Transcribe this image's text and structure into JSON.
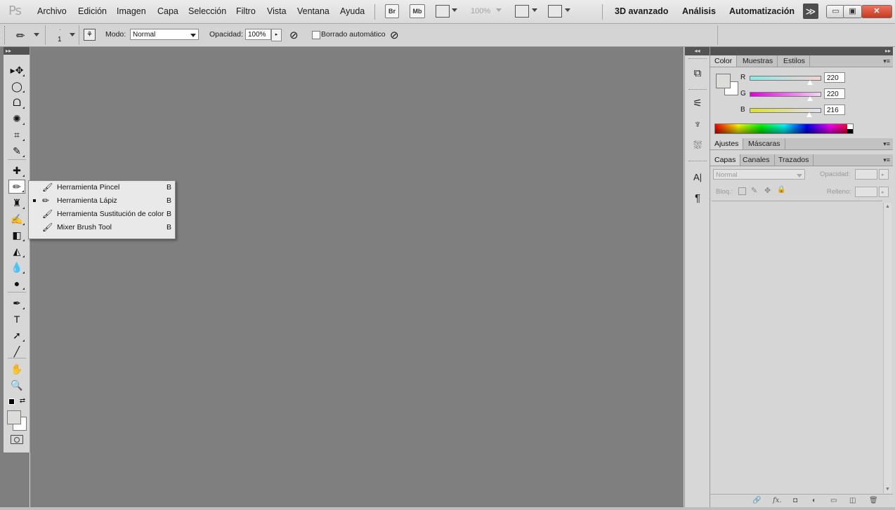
{
  "app": {
    "logo": "Ps",
    "menu": [
      "Archivo",
      "Edición",
      "Imagen",
      "Capa",
      "Selección",
      "Filtro",
      "Vista",
      "Ventana",
      "Ayuda"
    ],
    "bridge_label": "Br",
    "minibridge_label": "Mb",
    "zoom": "100%",
    "workspaces": [
      "3D avanzado",
      "Análisis",
      "Automatización"
    ],
    "more_glyph": "≫",
    "window_buttons": {
      "minimize": "▭",
      "restore": "▣",
      "close": "✕"
    }
  },
  "options": {
    "brush_size": "1",
    "mode_label": "Modo:",
    "mode_value": "Normal",
    "opacity_label": "Opacidad:",
    "opacity_value": "100%",
    "auto_erase_label": "Borrado automático"
  },
  "toolbox": {
    "collapse_glyph": "▸▸",
    "tools": [
      {
        "name": "move-tool-icon",
        "glyph": "▸✥"
      },
      {
        "name": "marquee-tool-icon",
        "glyph": "◯"
      },
      {
        "name": "lasso-tool-icon",
        "glyph": "ᗝ"
      },
      {
        "name": "quick-selection-tool-icon",
        "glyph": "✺"
      },
      {
        "name": "crop-tool-icon",
        "glyph": "⌗"
      },
      {
        "name": "eyedropper-tool-icon",
        "glyph": "✎"
      },
      {
        "name": "healing-brush-tool-icon",
        "glyph": "✚"
      },
      {
        "name": "pencil-tool-icon",
        "glyph": "✏"
      },
      {
        "name": "stamp-tool-icon",
        "glyph": "♜"
      },
      {
        "name": "history-brush-tool-icon",
        "glyph": "✍"
      },
      {
        "name": "eraser-tool-icon",
        "glyph": "◧"
      },
      {
        "name": "paint-bucket-tool-icon",
        "glyph": "◭"
      },
      {
        "name": "blur-tool-icon",
        "glyph": "💧"
      },
      {
        "name": "dodge-tool-icon",
        "glyph": "●"
      },
      {
        "name": "pen-tool-icon",
        "glyph": "✒"
      },
      {
        "name": "type-tool-icon",
        "glyph": "T"
      },
      {
        "name": "path-selection-tool-icon",
        "glyph": "➚"
      },
      {
        "name": "line-tool-icon",
        "glyph": "╱"
      },
      {
        "name": "hand-tool-icon",
        "glyph": "✋"
      },
      {
        "name": "zoom-tool-icon",
        "glyph": "🔍"
      }
    ]
  },
  "flyout": {
    "items": [
      {
        "label": "Herramienta Pincel",
        "key": "B",
        "selected": false
      },
      {
        "label": "Herramienta Lápiz",
        "key": "B",
        "selected": true
      },
      {
        "label": "Herramienta Sustitución de color",
        "key": "B",
        "selected": false
      },
      {
        "label": "Mixer Brush Tool",
        "key": "B",
        "selected": false
      }
    ]
  },
  "dock": {
    "collapse_glyph": "◂◂",
    "icons": [
      {
        "name": "history-panel-icon",
        "glyph": "⧉"
      },
      {
        "name": "brush-presets-icon",
        "glyph": "⚟"
      },
      {
        "name": "brush-panel-icon",
        "glyph": "♆"
      },
      {
        "name": "clone-source-icon",
        "glyph": "⛆"
      },
      {
        "name": "character-panel-icon",
        "glyph": "A|"
      },
      {
        "name": "paragraph-panel-icon",
        "glyph": "¶"
      }
    ]
  },
  "panels": {
    "expand_glyph": "▸▸",
    "color_tabs": [
      "Color",
      "Muestras",
      "Estilos"
    ],
    "color": {
      "channels": [
        {
          "label": "R",
          "value": "220",
          "level": 0.86,
          "gradient": "#8be8e4,#f6d2d2"
        },
        {
          "label": "G",
          "value": "220",
          "level": 0.86,
          "gradient": "#dd00dd,#f0d6f0"
        },
        {
          "label": "B",
          "value": "216",
          "level": 0.85,
          "gradient": "#e0e02a,#e0e0f6"
        }
      ]
    },
    "adjust_tabs": [
      "Ajustes",
      "Máscaras"
    ],
    "layer_tabs": [
      "Capas",
      "Canales",
      "Trazados"
    ],
    "layers": {
      "blend_mode": "Normal",
      "opacity_label": "Opacidad:",
      "lock_label": "Bloq.:",
      "fill_label": "Relleno:"
    },
    "footer_icons": [
      "🔗",
      "fx.",
      "◘",
      "◐",
      "▭",
      "◫",
      "🗑"
    ]
  },
  "colors": {
    "canvas": "#7f7f7f",
    "foreground": "#dcdcd8",
    "background": "#ffffff"
  }
}
